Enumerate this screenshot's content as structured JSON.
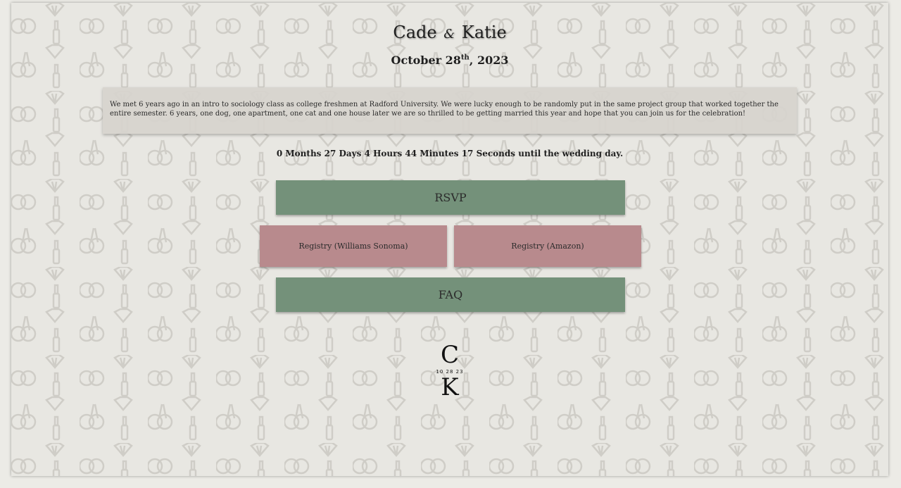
{
  "header": {
    "first_name": "Cade",
    "amp": "&",
    "second_name": "Katie",
    "date_main": "October 28",
    "date_suffix": "th",
    "date_year": ", 2023"
  },
  "story": {
    "text": "We met 6 years ago in an intro to sociology class as college freshmen at Radford University. We were lucky enough to be randomly put in the same project group that worked together the entire semester. 6 years, one dog, one apartment, one cat and one house later we are so thrilled to be getting married this year and hope that you can join us for the celebration!"
  },
  "countdown": {
    "text": "0 Months 27 Days 4 Hours 44 Minutes 17 Seconds until the wedding day."
  },
  "buttons": {
    "rsvp": "RSVP",
    "registry_ws": "Registry (Williams Sonoma)",
    "registry_amazon": "Registry (Amazon)",
    "faq": "FAQ"
  },
  "monogram": {
    "top": "C",
    "date": "10 28 23",
    "bottom": "K"
  },
  "colors": {
    "green": "#74917a",
    "pink": "#b88a8d",
    "background": "#e8e7e2"
  }
}
